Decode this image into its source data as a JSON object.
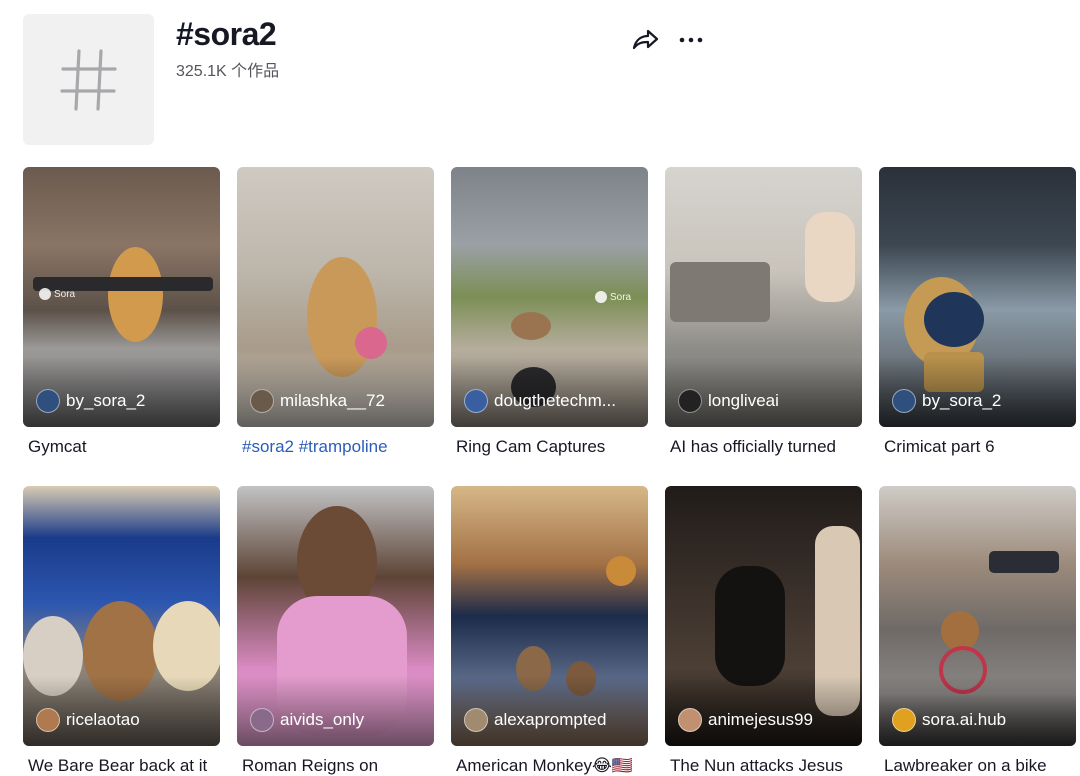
{
  "header": {
    "title": "#sora2",
    "count": "325.1K 个作品",
    "hash_symbol": "#"
  },
  "videos": [
    {
      "author": "by_sora_2",
      "caption": "Gymcat",
      "caption_style": "normal",
      "avatar_color": "#2f4f7f",
      "watermark": "Sora"
    },
    {
      "author": "milashka__72",
      "caption": "#sora2 #trampoline",
      "caption_style": "tag",
      "avatar_color": "#6a5a4a"
    },
    {
      "author": "dougthetechm...",
      "caption": "Ring Cam Captures",
      "caption_style": "normal",
      "avatar_color": "#3a5fa0",
      "watermark": "Sora"
    },
    {
      "author": "longliveai",
      "caption": "AI has officially turned",
      "caption_style": "normal",
      "avatar_color": "#222222"
    },
    {
      "author": "by_sora_2",
      "caption": "Crimicat part 6",
      "caption_style": "normal",
      "avatar_color": "#2f4f7f"
    },
    {
      "author": "ricelaotao",
      "caption": "We Bare Bear back at it",
      "caption_style": "normal",
      "avatar_color": "#b07a50"
    },
    {
      "author": "aivids_only",
      "caption": "Roman Reigns on",
      "caption_style": "normal",
      "avatar_color": "#8a6a8a"
    },
    {
      "author": "alexaprompted",
      "caption": "American Monkey😂🇺🇸",
      "caption_style": "normal",
      "avatar_color": "#a08a70"
    },
    {
      "author": "animejesus99",
      "caption": "The Nun attacks Jesus",
      "caption_style": "normal",
      "avatar_color": "#c09070"
    },
    {
      "author": "sora.ai.hub",
      "caption": "Lawbreaker on a bike",
      "caption_style": "normal",
      "avatar_color": "#e0a020"
    }
  ],
  "icons": {
    "share": "share-arrow-icon",
    "more": "more-dots-icon"
  }
}
